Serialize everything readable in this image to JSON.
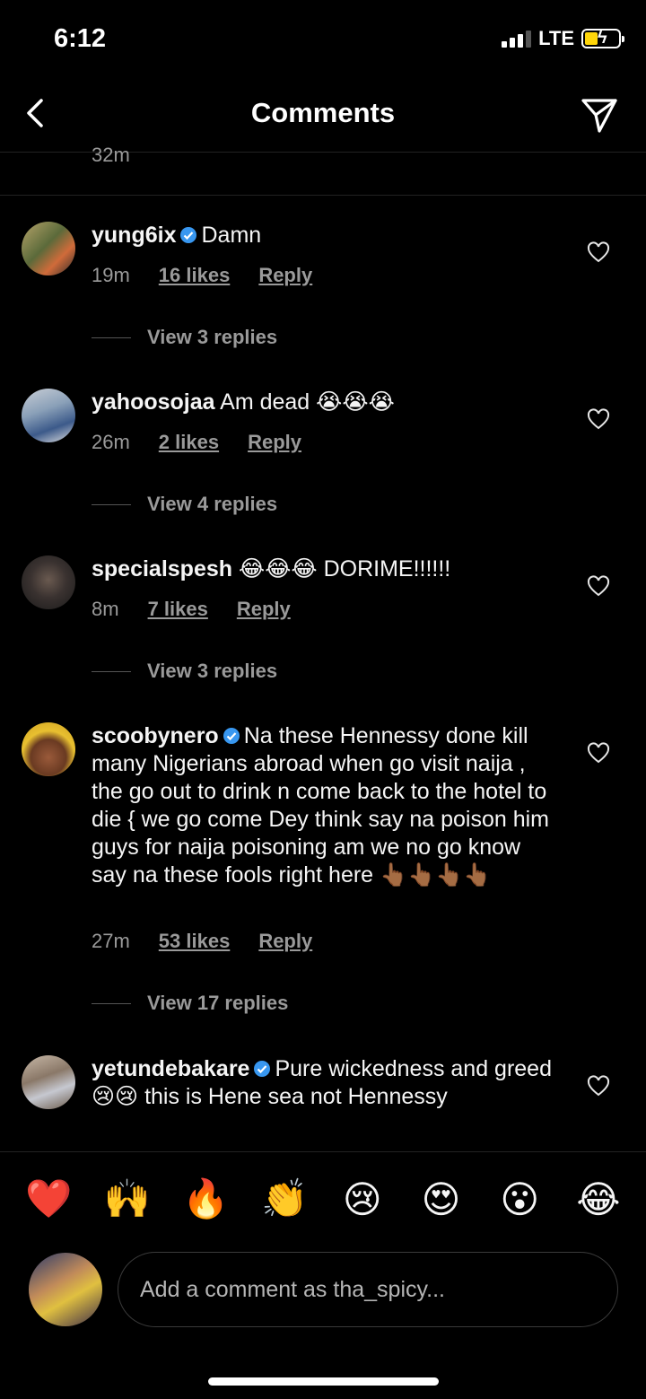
{
  "status": {
    "time": "6:12",
    "network": "LTE"
  },
  "header": {
    "title": "Comments"
  },
  "previous": {
    "time": "32m"
  },
  "comments": [
    {
      "user": "yung6ix",
      "verified": true,
      "text": "Damn",
      "time": "19m",
      "likes": "16 likes",
      "reply": "Reply",
      "view_replies": "View 3 replies"
    },
    {
      "user": "yahoosojaa",
      "verified": false,
      "text": "Am dead 😭😭😭",
      "time": "26m",
      "likes": "2 likes",
      "reply": "Reply",
      "view_replies": "View 4 replies"
    },
    {
      "user": "specialspesh",
      "verified": false,
      "text": "😂😂😂 DORIME!!!!!!",
      "time": "8m",
      "likes": "7 likes",
      "reply": "Reply",
      "view_replies": "View 3 replies"
    },
    {
      "user": "scoobynero",
      "verified": true,
      "text": "Na these Hennessy done kill many Nigerians abroad when go visit naija , the go out to drink n come back to the hotel to die { we go come Dey think say na poison him guys for naija poisoning am we no go know say na these fools right here 👆🏾👆🏾👆🏾👆🏾",
      "time": "27m",
      "likes": "53 likes",
      "reply": "Reply",
      "view_replies": "View 17 replies"
    },
    {
      "user": "yetundebakare",
      "verified": true,
      "text": "Pure wickedness and greed 😢😢 this is Hene sea not Hennessy"
    }
  ],
  "emoji_bar": [
    "❤️",
    "🙌",
    "🔥",
    "👏",
    "😢",
    "😍",
    "😮",
    "😂"
  ],
  "composer": {
    "placeholder": "Add a comment as tha_spicy..."
  },
  "colors": {
    "background": "#000000",
    "text": "#f5f5f5",
    "muted": "#9a9a9a",
    "verified": "#3897f0",
    "battery": "#ffd60a"
  }
}
